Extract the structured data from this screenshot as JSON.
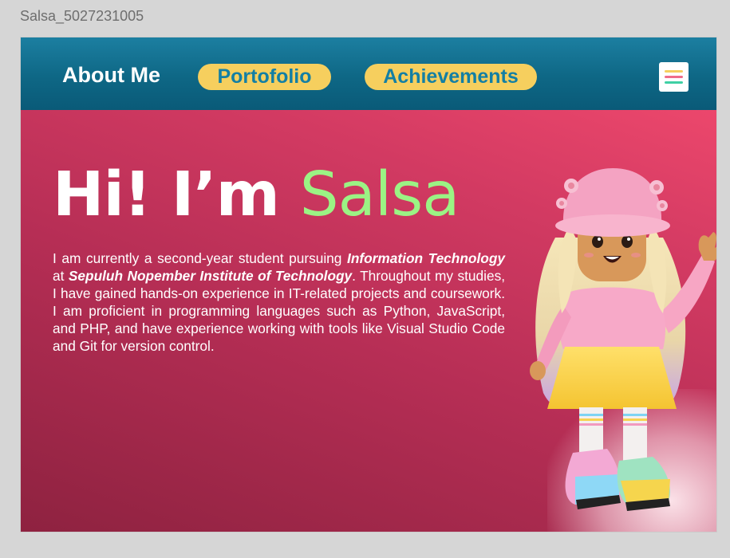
{
  "window": {
    "frame_label": "Salsa_5027231005"
  },
  "nav": {
    "about": "About Me",
    "portfolio": "Portofolio",
    "achievements": "Achievements",
    "menu_icon": "hamburger-menu-icon"
  },
  "hero": {
    "greeting": "Hi! I’m",
    "name": "Salsa",
    "bio_part1": "I am currently a second-year student pursuing ",
    "bio_major": "Information Technology",
    "bio_part2": " at ",
    "bio_institute": "Sepuluh Nopember Institute of Technology",
    "bio_part3": ". Throughout my studies, I have gained hands-on experience in IT-related projects and coursework. I am proficient in programming languages such as Python, JavaScript, and PHP, and have experience working with tools like Visual Studio Code and Git for version control."
  },
  "colors": {
    "nav_bg": "#0e6785",
    "pill_bg": "#f6cf5e",
    "pill_text": "#137fa4",
    "hero_bg_top": "#ec476c",
    "hero_bg_bottom": "#8e2240",
    "name_accent": "#9bf384"
  }
}
